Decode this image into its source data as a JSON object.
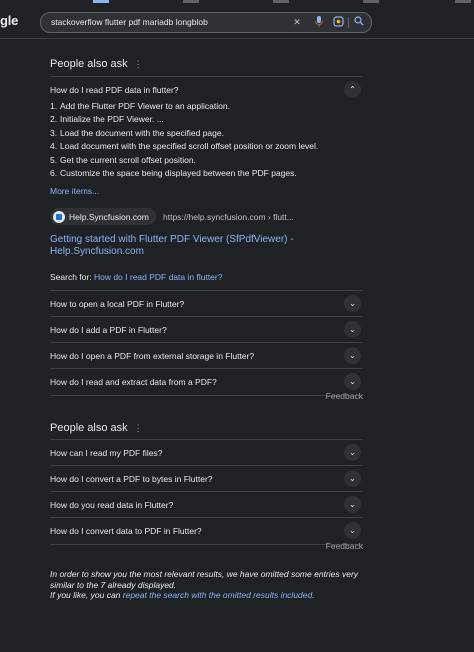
{
  "header": {
    "logo_fragment": "gle",
    "search_query": "stackoverflow flutter pdf mariadb longblob",
    "icons": [
      "close-icon",
      "mic-icon",
      "lens-icon",
      "search-icon"
    ]
  },
  "first_paa": {
    "title": "People also ask",
    "expanded_question": "How do I read PDF data in flutter?",
    "steps": [
      {
        "n": "1.",
        "text": "Add the Flutter PDF Viewer to an application."
      },
      {
        "n": "2.",
        "text": "Initialize the PDF Viewer. ..."
      },
      {
        "n": "3.",
        "text": "Load the document with the specified page."
      },
      {
        "n": "4.",
        "text": "Load document with the specified scroll offset position or zoom level."
      },
      {
        "n": "5.",
        "text": "Get the current scroll offset position."
      },
      {
        "n": "6.",
        "text": "Customize the space being displayed between the PDF pages."
      }
    ],
    "more_items": "More items...",
    "source_name": "Help.Syncfusion.com",
    "source_url": "https://help.syncfusion.com › flutt...",
    "result_title": "Getting started with Flutter PDF Viewer (SfPdfViewer) - Help.Syncfusion.com",
    "search_for_label": "Search for:",
    "search_for_link": "How do I read PDF data in flutter?",
    "questions": [
      "How to open a local PDF in Flutter?",
      "How do I add a PDF in Flutter?",
      "How do I open a PDF from external storage in Flutter?",
      "How do I read and extract data from a PDF?"
    ],
    "feedback": "Feedback"
  },
  "second_paa": {
    "title": "People also ask",
    "questions": [
      "How can I read my PDF files?",
      "How do I convert a PDF to bytes in Flutter?",
      "How do you read data in Flutter?",
      "How do I convert data to PDF in Flutter?"
    ],
    "feedback": "Feedback"
  },
  "omitted": {
    "line1": "In order to show you the most relevant results, we have omitted some entries very similar to the 7 already displayed.",
    "prefix": "If you like, you can ",
    "link": "repeat the search with the omitted results included",
    "suffix": "."
  }
}
